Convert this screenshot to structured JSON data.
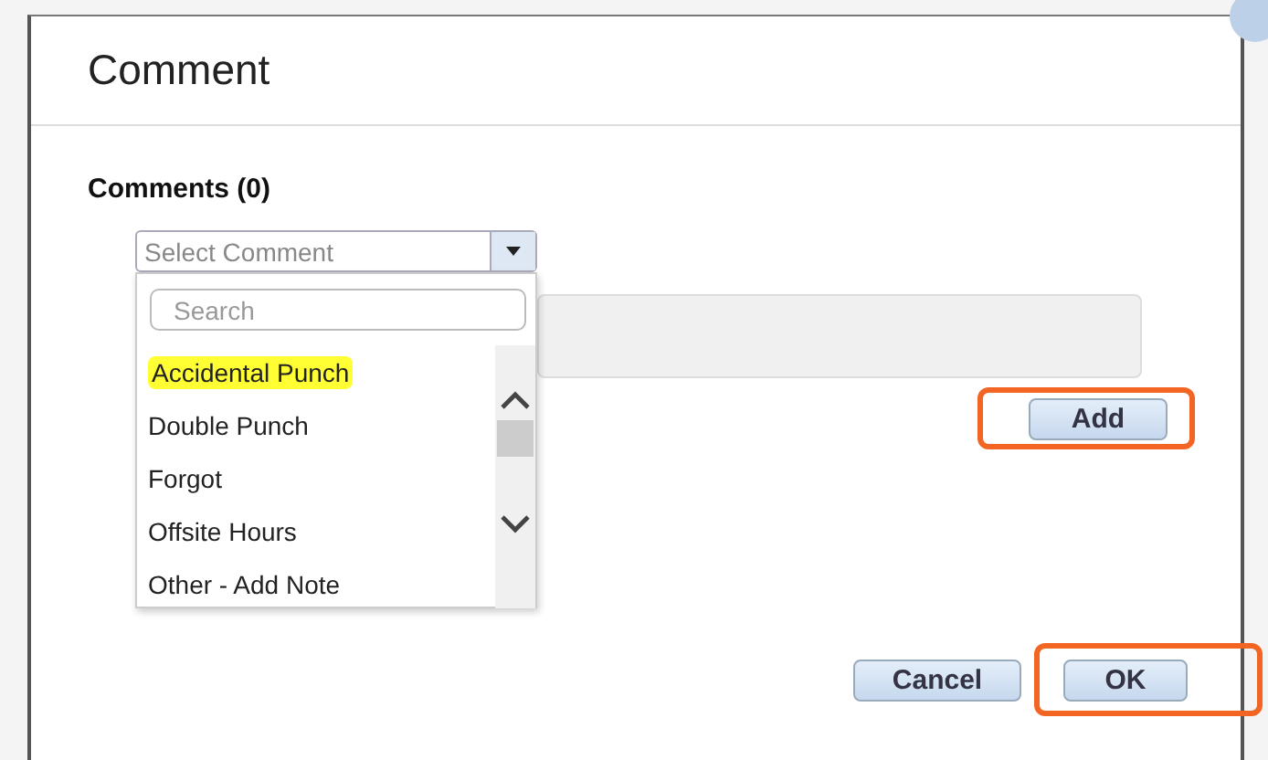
{
  "dialog": {
    "title": "Comment",
    "section_label": "Comments (0)",
    "select": {
      "placeholder": "Select Comment",
      "expanded": true
    },
    "dropdown": {
      "search_placeholder": "Search",
      "options": [
        {
          "label": "Accidental Punch",
          "highlighted": true
        },
        {
          "label": "Double Punch",
          "highlighted": false
        },
        {
          "label": "Forgot",
          "highlighted": false
        },
        {
          "label": "Offsite Hours",
          "highlighted": false
        },
        {
          "label": "Other - Add Note",
          "highlighted": false
        }
      ]
    },
    "add_button": {
      "label": "Add",
      "annotated": true
    },
    "buttons": [
      {
        "label": "Cancel",
        "annotated": false
      },
      {
        "label": "OK",
        "annotated": true
      }
    ]
  }
}
